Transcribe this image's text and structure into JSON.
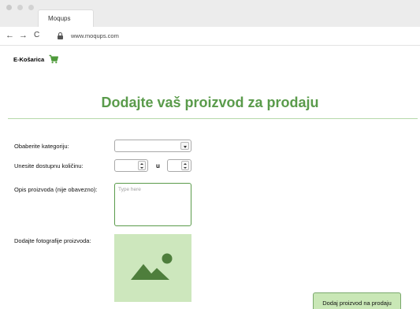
{
  "browser": {
    "tab_title": "Moqups",
    "url": "www.moqups.com",
    "nav": {
      "back": "←",
      "forward": "→",
      "reload": "C"
    }
  },
  "header": {
    "brand": "E-Košarica",
    "cart_icon": "shopping-cart-icon"
  },
  "main": {
    "title": "Dodajte vaš proizvod za prodaju"
  },
  "form": {
    "category_label": "Obaberite kategoriju:",
    "category_value": "",
    "quantity_label": "Unesite dostupnu količinu:",
    "quantity_value": "",
    "quantity_separator": "u",
    "unit_value": "",
    "description_label": "Opis proizvoda (nije obavezno):",
    "description_placeholder": "Type here",
    "photo_label": "Dodajte fotografije proizvoda:",
    "photo_icon": "image-placeholder-icon",
    "submit_label": "Dodaj proizvod na prodaju"
  },
  "colors": {
    "accent": "#5a9b4b",
    "accent_light": "#cde7bd",
    "button_bg": "#c9e7b6"
  }
}
